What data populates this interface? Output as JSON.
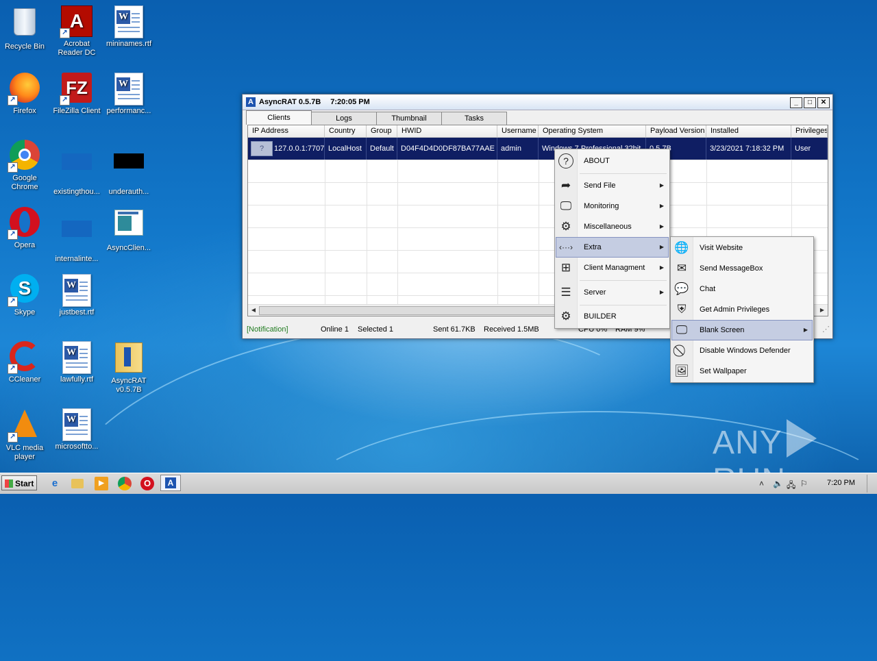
{
  "desktop": {
    "icons": [
      {
        "label": "Recycle Bin"
      },
      {
        "label": "Acrobat Reader DC"
      },
      {
        "label": "mininames.rtf"
      },
      {
        "label": "Firefox"
      },
      {
        "label": "FileZilla Client"
      },
      {
        "label": "performanc..."
      },
      {
        "label": "Google Chrome"
      },
      {
        "label": "existingthou..."
      },
      {
        "label": "underauth..."
      },
      {
        "label": "Opera"
      },
      {
        "label": "internalinte..."
      },
      {
        "label": "AsyncClien..."
      },
      {
        "label": "Skype"
      },
      {
        "label": "justbest.rtf"
      },
      {
        "label": "CCleaner"
      },
      {
        "label": "lawfully.rtf"
      },
      {
        "label": "AsyncRAT v0.5.7B"
      },
      {
        "label": "VLC media player"
      },
      {
        "label": "microsoftto..."
      }
    ]
  },
  "window": {
    "title": "AsyncRAT 0.5.7B",
    "time": "7:20:05 PM",
    "controls": {
      "minimize": "_",
      "maximize": "□",
      "close": "✕"
    },
    "tabs": [
      "Clients",
      "Logs",
      "Thumbnail",
      "Tasks"
    ],
    "columns": [
      "IP Address",
      "Country",
      "Group",
      "HWID",
      "Username",
      "Operating System",
      "Payload Version",
      "Installed",
      "Privileges"
    ],
    "rows": [
      {
        "flag": "?",
        "ip": "127.0.0.1:7707",
        "country": "LocalHost",
        "group": "Default",
        "hwid": "D04F4D4D0DF87BA77AAE",
        "username": "admin",
        "os": "Windows 7 Professional 32bit",
        "payload": "0.5.7B",
        "installed": "3/23/2021 7:18:32 PM",
        "privileges": "User"
      }
    ],
    "status": {
      "notification": "[Notification]",
      "online": "Online 1",
      "selected": "Selected 1",
      "sent": "Sent 61.7KB",
      "received": "Received 1.5MB",
      "cpu": "CPU 0%",
      "ram": "RAM 9%"
    }
  },
  "context_menu": {
    "items": [
      {
        "label": "ABOUT",
        "icon": "question-icon"
      },
      {
        "label": "Send File",
        "icon": "share-arrow-icon"
      },
      {
        "label": "Monitoring",
        "icon": "monitor-icon"
      },
      {
        "label": "Miscellaneous",
        "icon": "head-gear-icon"
      },
      {
        "label": "Extra",
        "icon": "dots-arrows-icon"
      },
      {
        "label": "Client Managment",
        "icon": "windows-grid-icon"
      },
      {
        "label": "Server",
        "icon": "server-icon"
      },
      {
        "label": "BUILDER",
        "icon": "gear-icon"
      }
    ]
  },
  "submenu": {
    "items": [
      {
        "label": "Visit Website",
        "icon": "globe-icon"
      },
      {
        "label": "Send MessageBox",
        "icon": "envelope-icon"
      },
      {
        "label": "Chat",
        "icon": "chat-icon"
      },
      {
        "label": "Get Admin Privileges",
        "icon": "shield-icon"
      },
      {
        "label": "Blank Screen",
        "icon": "monitor-icon"
      },
      {
        "label": "Disable Windows Defender",
        "icon": "prohibited-icon"
      },
      {
        "label": "Set Wallpaper",
        "icon": "picture-icon"
      }
    ]
  },
  "taskbar": {
    "start_label": "Start",
    "clock": "7:20 PM"
  },
  "watermark": {
    "left": "ANY",
    "right": "RUN"
  }
}
